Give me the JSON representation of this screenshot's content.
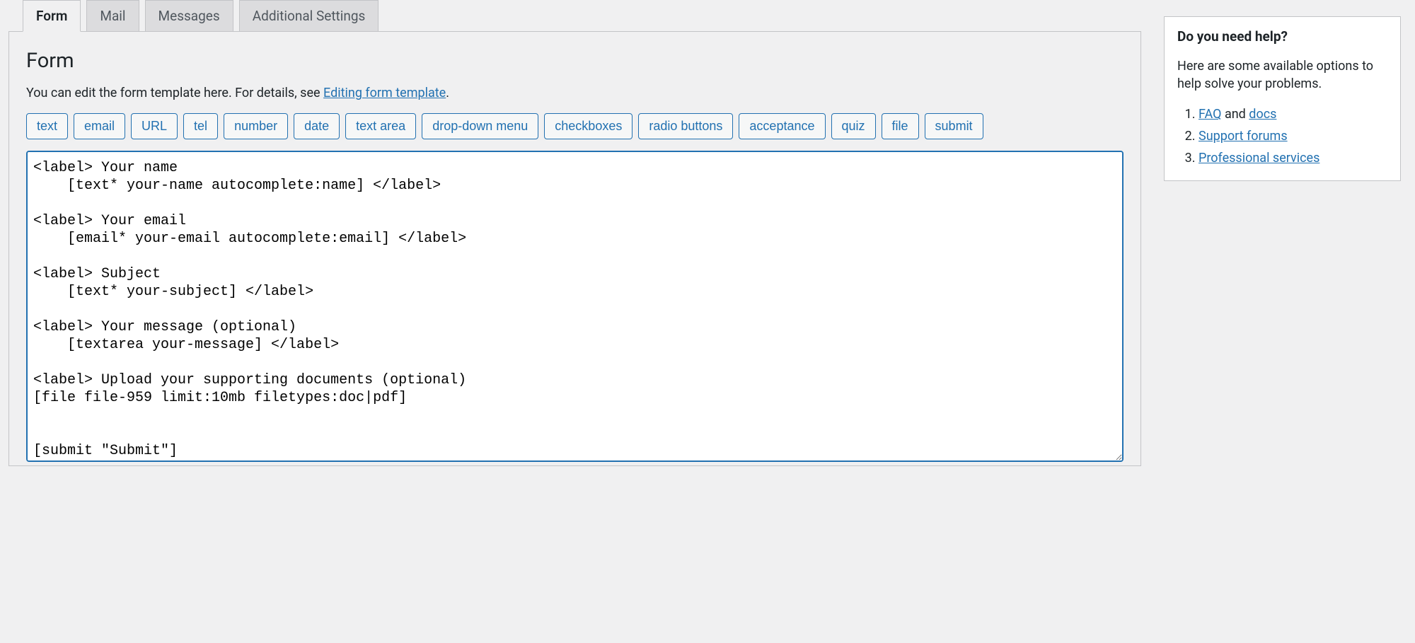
{
  "tabs": [
    {
      "label": "Form",
      "active": true
    },
    {
      "label": "Mail",
      "active": false
    },
    {
      "label": "Messages",
      "active": false
    },
    {
      "label": "Additional Settings",
      "active": false
    }
  ],
  "panel": {
    "title": "Form",
    "description_prefix": "You can edit the form template here. For details, see ",
    "description_link": "Editing form template",
    "description_suffix": "."
  },
  "tag_buttons": [
    "text",
    "email",
    "URL",
    "tel",
    "number",
    "date",
    "text area",
    "drop-down menu",
    "checkboxes",
    "radio buttons",
    "acceptance",
    "quiz",
    "file",
    "submit"
  ],
  "form_code": "<label> Your name\n    [text* your-name autocomplete:name] </label>\n\n<label> Your email\n    [email* your-email autocomplete:email] </label>\n\n<label> Subject\n    [text* your-subject] </label>\n\n<label> Your message (optional)\n    [textarea your-message] </label>\n\n<label> Upload your supporting documents (optional)\n[file file-959 limit:10mb filetypes:doc|pdf]\n\n\n[submit \"Submit\"]",
  "help": {
    "title": "Do you need help?",
    "intro": "Here are some available options to help solve your problems.",
    "items": [
      {
        "link": "FAQ",
        "suffix": " and ",
        "link2": "docs"
      },
      {
        "link": "Support forums",
        "suffix": "",
        "link2": ""
      },
      {
        "link": "Professional services",
        "suffix": "",
        "link2": ""
      }
    ]
  }
}
